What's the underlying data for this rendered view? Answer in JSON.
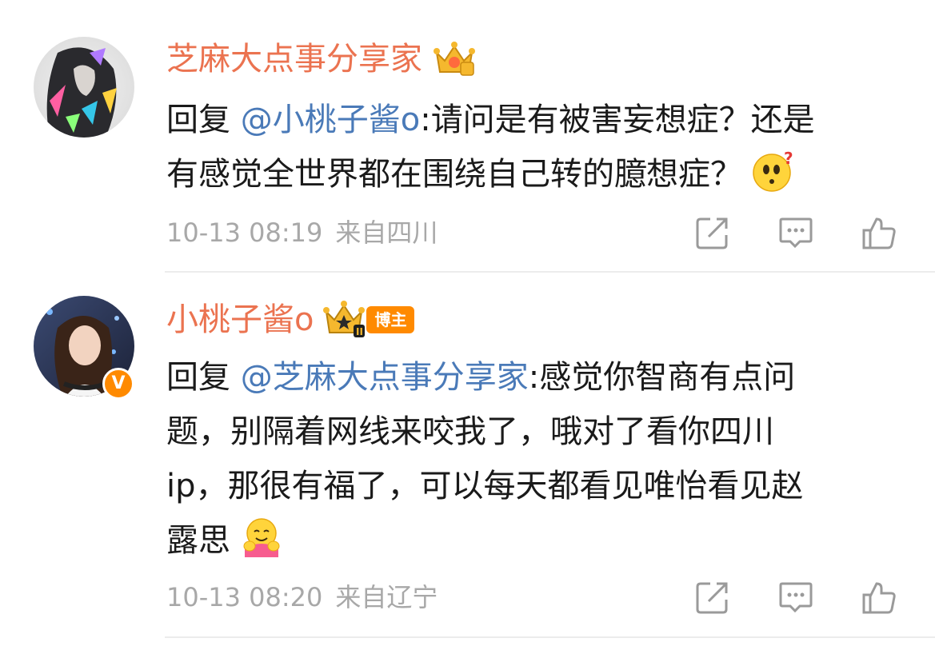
{
  "comments": [
    {
      "username": "芝麻大点事分享家",
      "reply_prefix": "回复 ",
      "mention": "@小桃子酱o",
      "body_lines": [
        "请问是有被害妄想症？还是",
        "有感觉全世界都在围绕自己转的臆想症？"
      ],
      "emoji": "thinking-question-emoji",
      "time": "10-13 08:19",
      "location": "来自四川",
      "badge": "crown-gold-icon"
    },
    {
      "username": "小桃子酱o",
      "badge_label": "博主",
      "verified": "V",
      "reply_prefix": "回复 ",
      "mention": "@芝麻大点事分享家",
      "body_lines": [
        "感觉你智商有点问",
        "题，别隔着网线来咬我了，哦对了看你四川",
        "ip，那很有福了，可以每天都看见唯怡看见赵",
        "露思"
      ],
      "emoji": "hugging-emoji",
      "time": "10-13 08:20",
      "location": "来自辽宁"
    }
  ],
  "actions": {
    "share_icon": "share-icon",
    "reply_icon": "reply-comment-icon",
    "like_icon": "thumbs-up-icon"
  },
  "colors": {
    "username": "#eb7350",
    "mention": "#4a7ab8",
    "meta": "#a8a8a8",
    "badge": "#ff8a00"
  }
}
